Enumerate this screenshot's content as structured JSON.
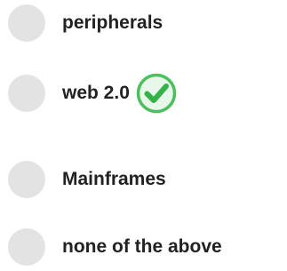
{
  "question": {
    "options": [
      {
        "label": "peripherals",
        "selected": false,
        "correct": false
      },
      {
        "label": "web 2.0",
        "selected": false,
        "correct": true
      },
      {
        "label": "Mainframes",
        "selected": false,
        "correct": false
      },
      {
        "label": "none of the above",
        "selected": false,
        "correct": false
      }
    ],
    "correct_indicator_icon": "checkmark-circle-icon",
    "colors": {
      "radio_fill": "#e3e3e3",
      "label_text": "#222222",
      "check_green": "#34b24a",
      "check_ring": "#4cbf5e",
      "check_fill_light": "#e9f7ea"
    }
  }
}
